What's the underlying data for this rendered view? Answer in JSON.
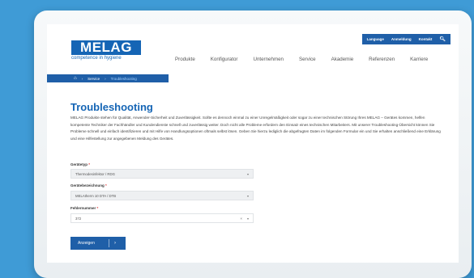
{
  "topbar": {
    "language": "Language",
    "login": "Anmeldung",
    "contact": "Kontakt"
  },
  "logo": {
    "brand": "MELAG",
    "tagline": "competence in hygiene"
  },
  "nav": [
    "Produkte",
    "Konfigurator",
    "Unternehmen",
    "Service",
    "Akademie",
    "Referenzen",
    "Karriere"
  ],
  "breadcrumb": {
    "home_icon": "home-icon",
    "service": "Service",
    "current": "Troubleshooting"
  },
  "page": {
    "title": "Troubleshooting",
    "description": "MELAG Produkte stehen für Qualität, Anwender-Sicherheit und Zuverlässigkeit. Sollte es dennoch einmal zu einer Unregelmäßigkeit oder sogar zu einer technischen Störung Ihres MELAG – Gerätes kommen, helfen kompetente Techniker der Fachhändler und Kundendienste schnell und zuverlässig weiter. Doch nicht alle Probleme erfordern den Einsatz eines technischen Mitarbeiters. Mit unserer Troubleshooting-Übersicht können Sie Probleme schnell und einfach identifizieren und mit Hilfe von Handlungsoptionen oftmals selbst lösen. Geben Sie hierzu lediglich die abgefragten Daten im folgenden Formular ein und Sie erhalten anschließend eine Erklärung und eine Hilfestellung zur angegebenen Meldung des Gerätes."
  },
  "form": {
    "device_type_label": "Gerätetyp",
    "device_type_value": "Thermodesinfektor / RDG",
    "device_name_label": "Gerätebezeichnung",
    "device_name_value": "MELAtherm 10 DTA / DTB",
    "error_label": "Fehlernummer",
    "error_value": "372",
    "required": "*",
    "submit": "Anzeigen"
  },
  "colors": {
    "brand": "#1565b5",
    "bar": "#1f5fa8",
    "background": "#3f9bd6"
  }
}
